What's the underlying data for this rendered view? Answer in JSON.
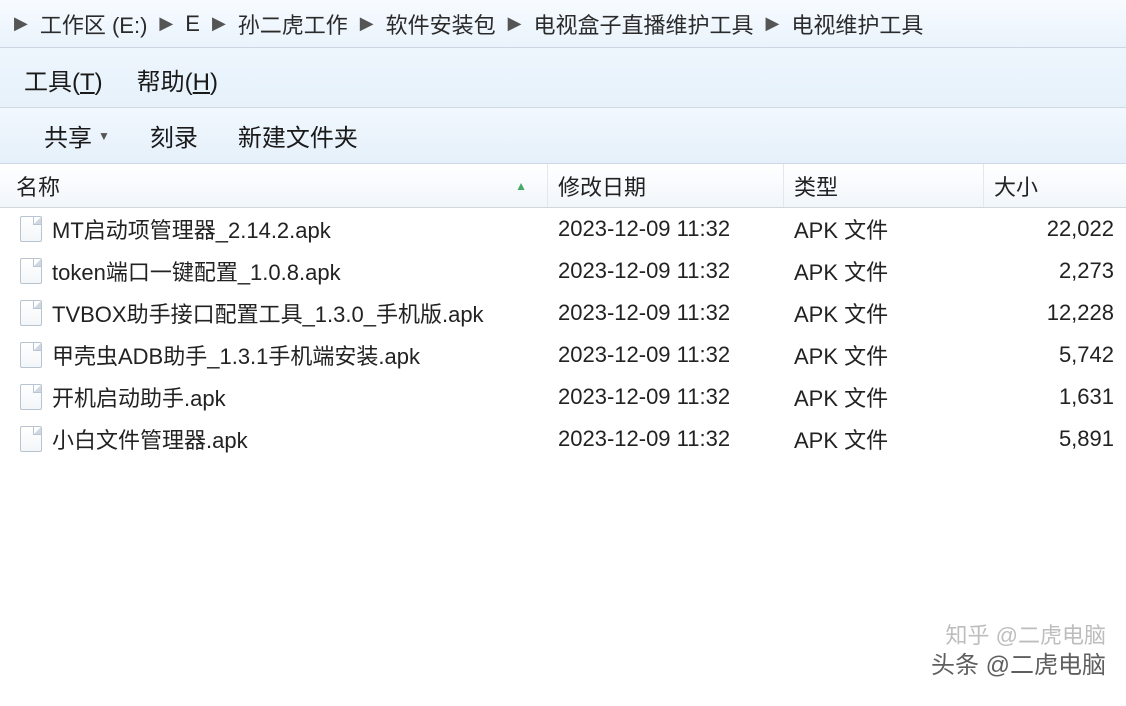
{
  "breadcrumb": [
    "工作区 (E:)",
    "E",
    "孙二虎工作",
    "软件安装包",
    "电视盒子直播维护工具",
    "电视维护工具"
  ],
  "menubar": {
    "tools": "工具",
    "tools_accel": "T",
    "help": "帮助",
    "help_accel": "H"
  },
  "toolbar": {
    "share": "共享",
    "burn": "刻录",
    "new_folder": "新建文件夹"
  },
  "columns": {
    "name": "名称",
    "date": "修改日期",
    "type": "类型",
    "size": "大小"
  },
  "files": [
    {
      "name": "MT启动项管理器_2.14.2.apk",
      "date": "2023-12-09 11:32",
      "type": "APK 文件",
      "size": "22,022"
    },
    {
      "name": "token端口一键配置_1.0.8.apk",
      "date": "2023-12-09 11:32",
      "type": "APK 文件",
      "size": "2,273"
    },
    {
      "name": "TVBOX助手接口配置工具_1.3.0_手机版.apk",
      "date": "2023-12-09 11:32",
      "type": "APK 文件",
      "size": "12,228"
    },
    {
      "name": "甲壳虫ADB助手_1.3.1手机端安装.apk",
      "date": "2023-12-09 11:32",
      "type": "APK 文件",
      "size": "5,742"
    },
    {
      "name": "开机启动助手.apk",
      "date": "2023-12-09 11:32",
      "type": "APK 文件",
      "size": "1,631"
    },
    {
      "name": "小白文件管理器.apk",
      "date": "2023-12-09 11:32",
      "type": "APK 文件",
      "size": "5,891"
    }
  ],
  "watermark1": "知乎 @二虎电脑",
  "watermark2": "头条 @二虎电脑"
}
